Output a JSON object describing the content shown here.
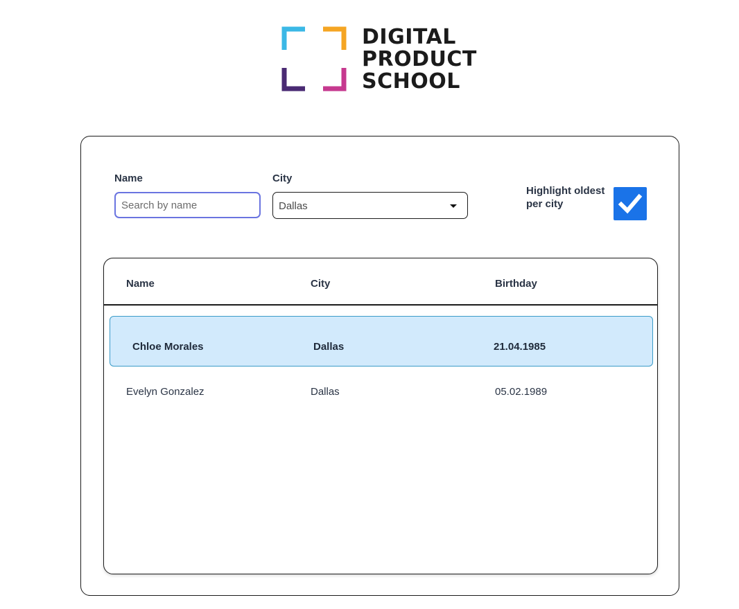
{
  "logo": {
    "lines": [
      "DIGITAL",
      "PRODUCT",
      "SCHOOL"
    ],
    "colors": {
      "top_left": "#3bb8e6",
      "top_right": "#f5a523",
      "bottom_left": "#4a2a73",
      "bottom_right": "#c6398f"
    }
  },
  "filters": {
    "name_label": "Name",
    "name_placeholder": "Search by name",
    "name_value": "",
    "city_label": "City",
    "city_selected": "Dallas",
    "highlight_label": "Highlight oldest per city",
    "highlight_checked": true
  },
  "table": {
    "headers": [
      "Name",
      "City",
      "Birthday"
    ],
    "rows": [
      {
        "name": "Chloe Morales",
        "city": "Dallas",
        "birthday": "21.04.1985",
        "highlighted": true
      },
      {
        "name": "Evelyn Gonzalez",
        "city": "Dallas",
        "birthday": "05.02.1989",
        "highlighted": false
      }
    ]
  },
  "colors": {
    "accent": "#1a73e8",
    "highlight_row_bg": "#d2eafc",
    "highlight_row_border": "#3a9bc8",
    "input_focus_border": "#6a74e0"
  }
}
